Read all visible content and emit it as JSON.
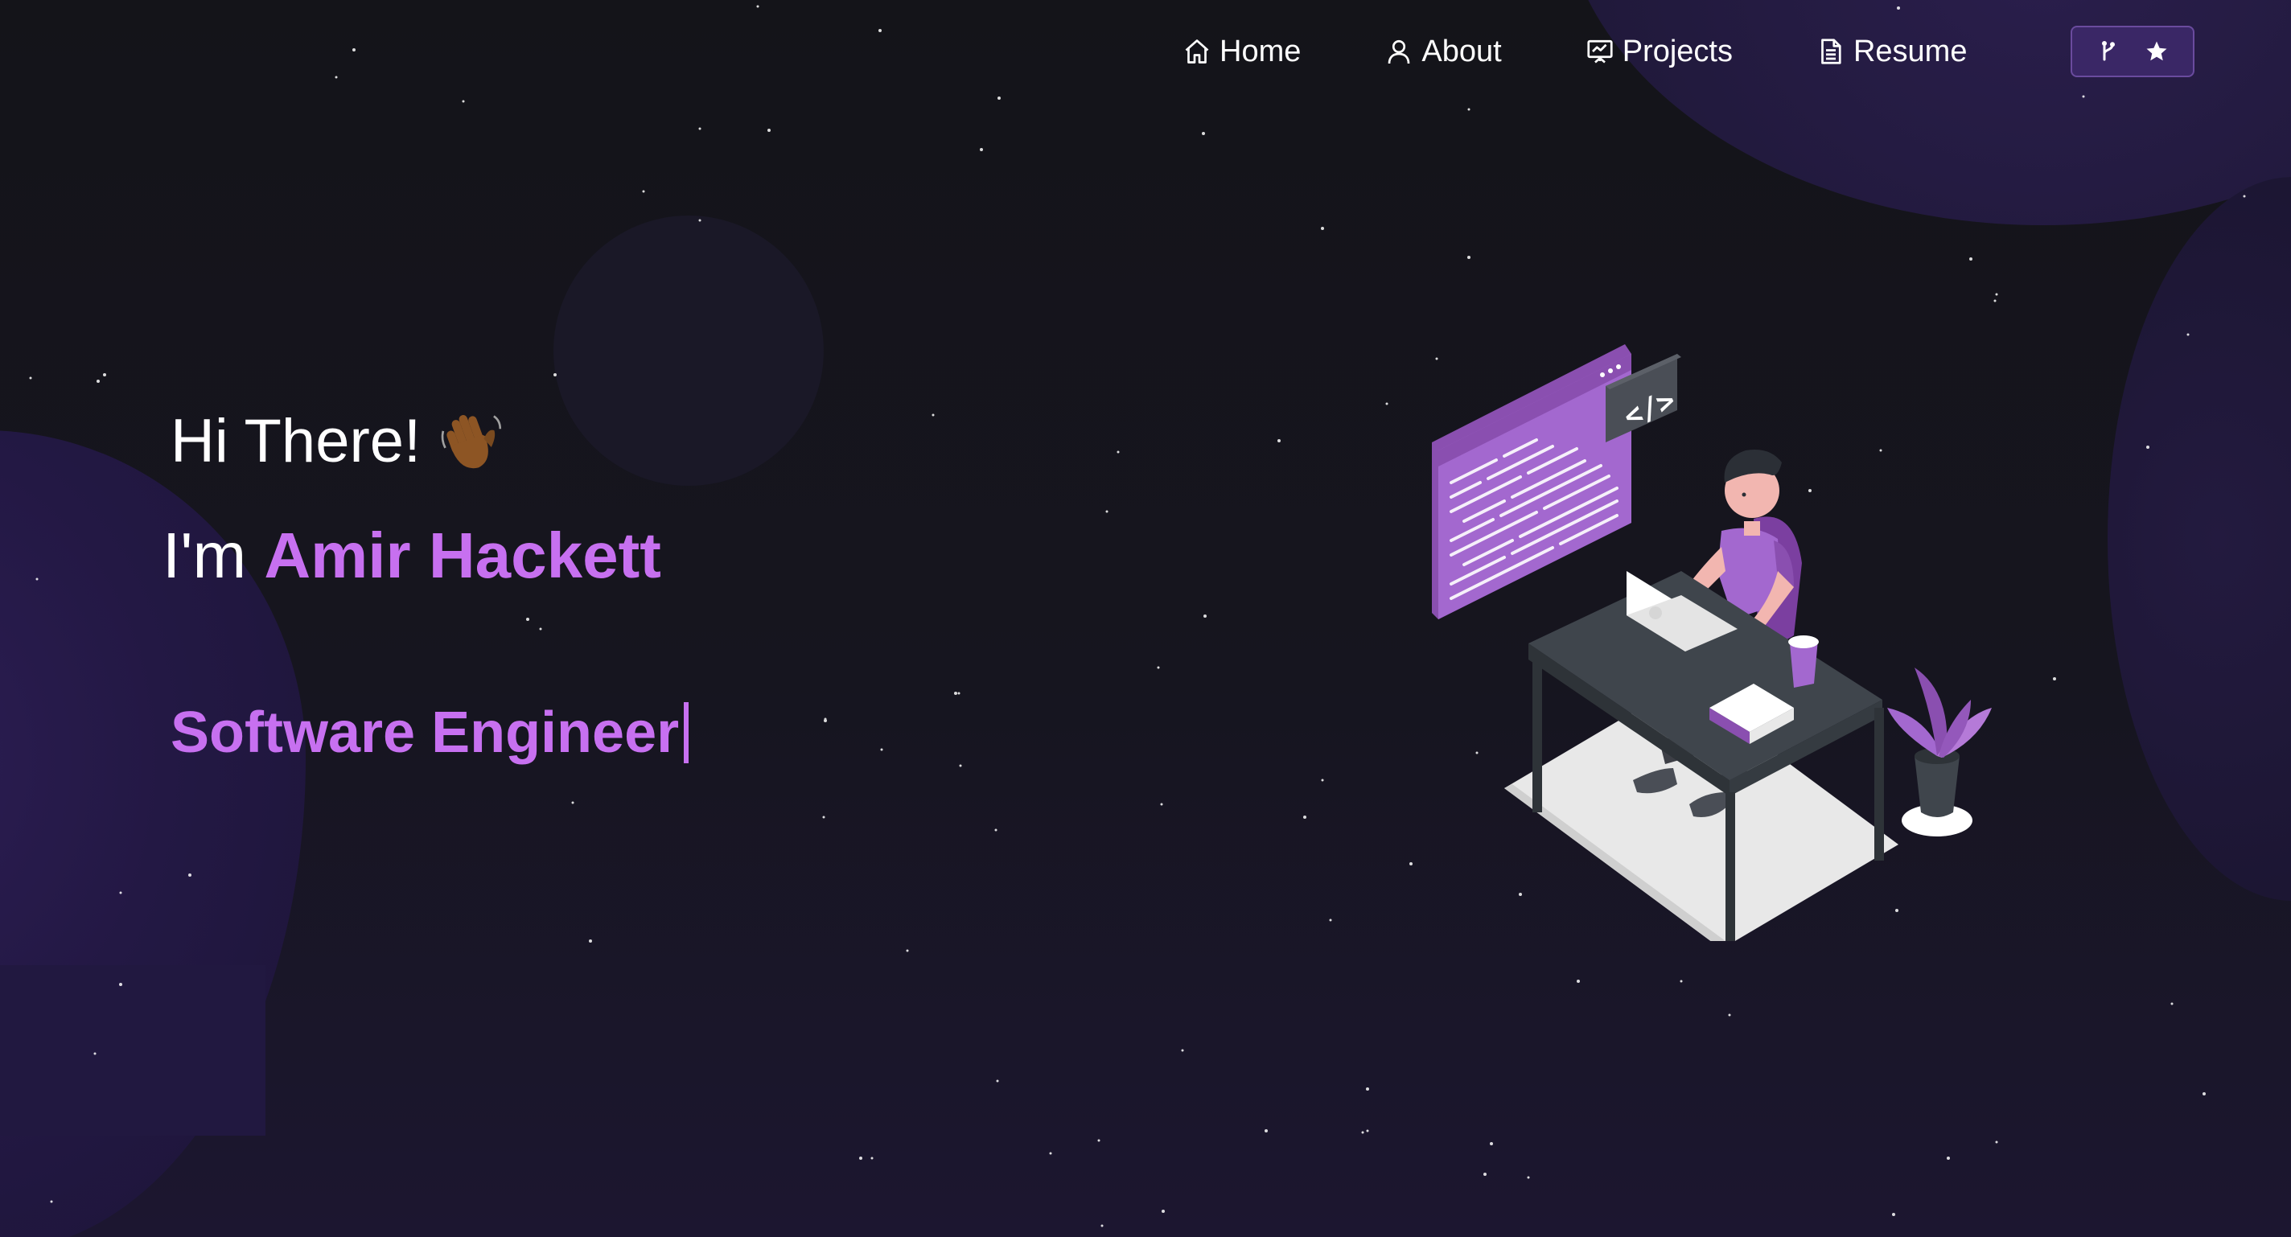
{
  "nav": {
    "items": [
      {
        "label": "Home",
        "icon": "home-icon"
      },
      {
        "label": "About",
        "icon": "user-icon"
      },
      {
        "label": "Projects",
        "icon": "presentation-icon"
      },
      {
        "label": "Resume",
        "icon": "document-icon"
      }
    ],
    "github_button": {
      "icons": [
        "git-fork-icon",
        "star-icon"
      ]
    }
  },
  "hero": {
    "greeting": "Hi There!",
    "greeting_emoji": "waving-hand-icon",
    "intro_prefix": "I'm",
    "name": "Amir Hackett",
    "role": "Software Engineer"
  },
  "colors": {
    "accent": "#c770f0",
    "background": "#15151c",
    "button_bg": "#3a2766"
  }
}
